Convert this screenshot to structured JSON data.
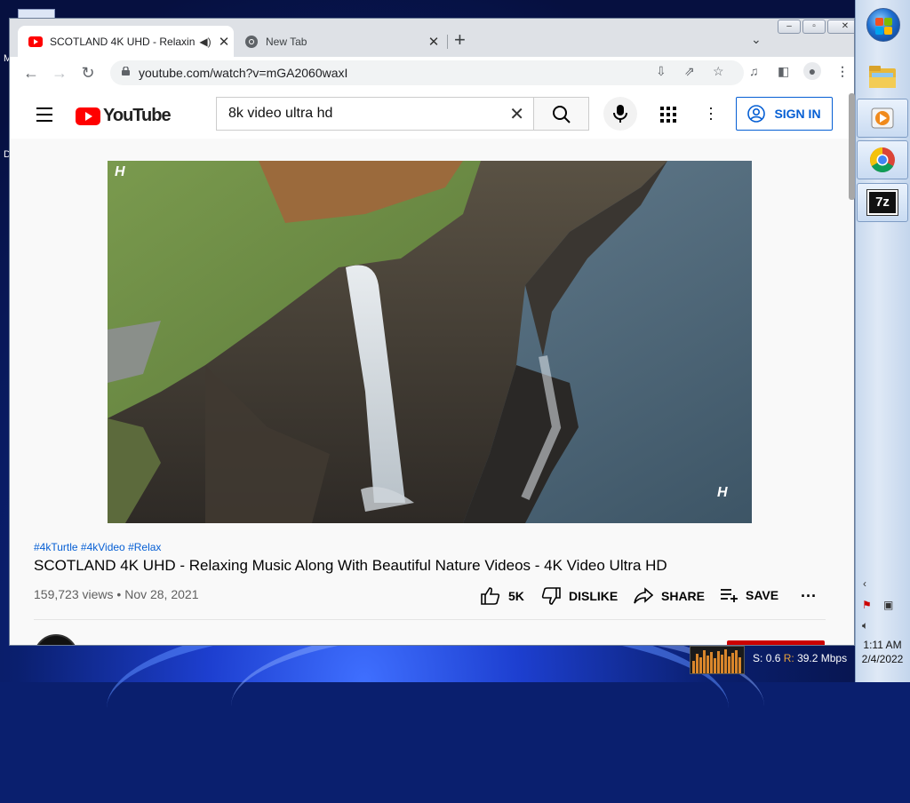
{
  "desktop": {
    "left_labels": [
      "M",
      "D"
    ],
    "network_speed": {
      "s_label": "S:",
      "s_value": "0.6",
      "r_label": "R:",
      "r_value": "39.2 Mbps"
    }
  },
  "taskbar": {
    "items": [
      {
        "name": "windows-explorer",
        "icon": "folder-icon"
      },
      {
        "name": "media-player",
        "icon": "media-player-icon"
      },
      {
        "name": "chrome",
        "icon": "chrome-icon"
      },
      {
        "name": "7zip",
        "icon": "7zip-icon",
        "label": "7z"
      }
    ],
    "clock_time": "1:11 AM",
    "clock_date": "2/4/2022"
  },
  "browser": {
    "tabs": [
      {
        "title": "SCOTLAND 4K UHD - Relaxin",
        "favicon": "youtube-icon",
        "audio": true,
        "active": true
      },
      {
        "title": "New Tab",
        "favicon": "chrome-icon",
        "active": false
      }
    ],
    "url": "youtube.com/watch?v=mGA2060waxI"
  },
  "youtube": {
    "logo_text": "YouTube",
    "search_query": "8k video ultra hd",
    "sign_in_label": "SIGN IN",
    "video": {
      "hashtags": "#4kTurtle #4kVideo #Relax",
      "title": "SCOTLAND 4K UHD - Relaxing Music Along With Beautiful Nature Videos - 4K Video Ultra HD",
      "views": "159,723 views",
      "date": "Nov 28, 2021",
      "watermark": "H",
      "like_count": "5K",
      "dislike_label": "DISLIKE",
      "share_label": "SHARE",
      "save_label": "SAVE"
    }
  },
  "colors": {
    "brand_red": "#ff0000",
    "link_blue": "#065fd4"
  }
}
